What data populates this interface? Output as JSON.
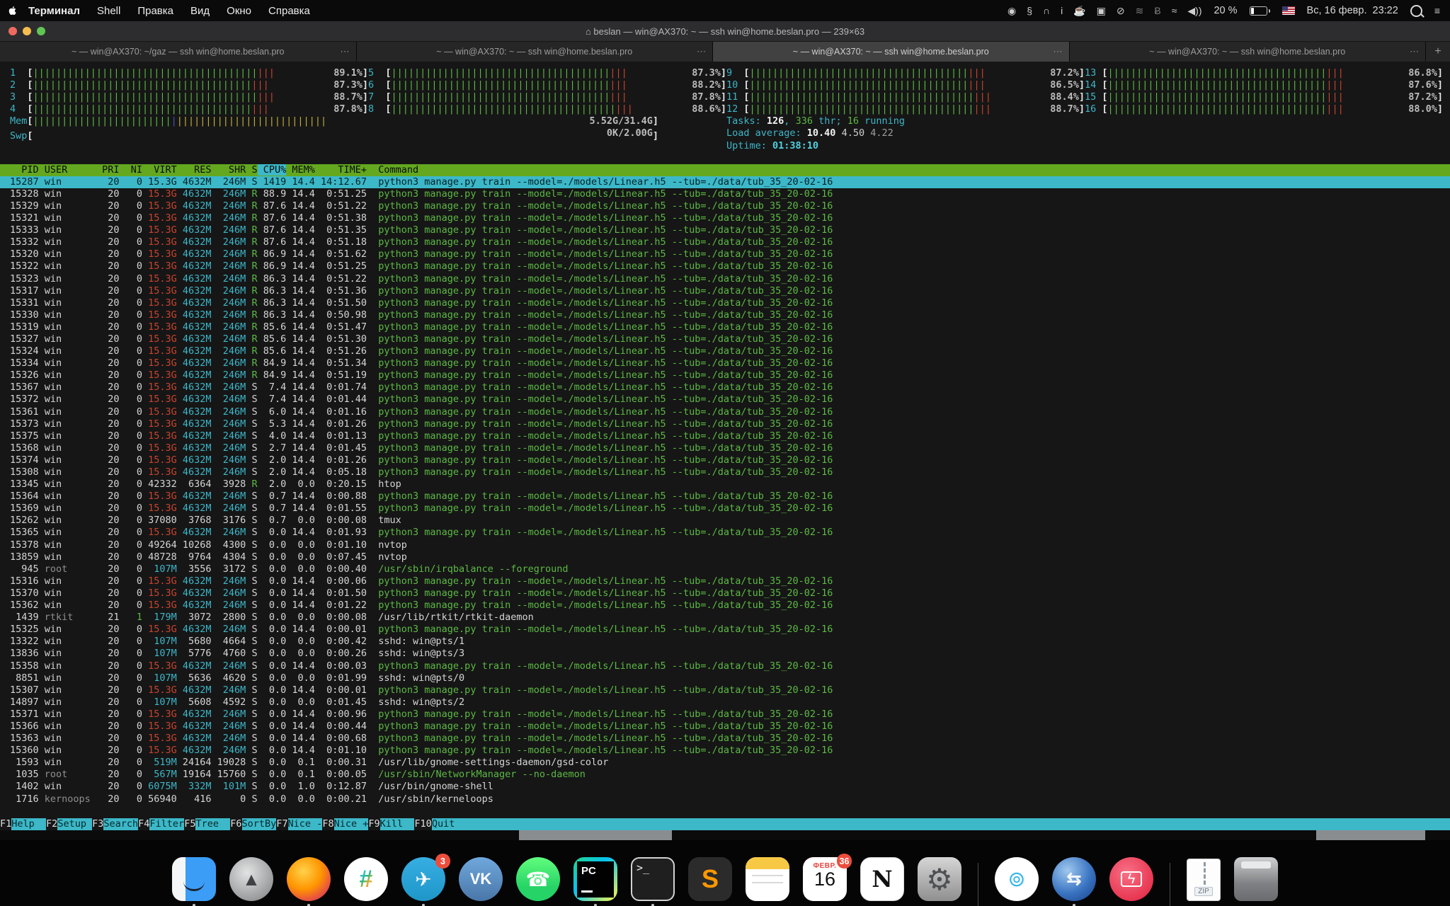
{
  "palette": {
    "bg": "#161616",
    "green": "#5cb944",
    "red": "#c8442e",
    "yellow": "#c2b13d",
    "blue": "#4d4fc9",
    "cyan": "#3db6c8",
    "cyanBright": "#4fd1e0",
    "headerGreen": "#63a81f",
    "selCyan": "#3cb8c8",
    "text": "#d6d6d6",
    "gray": "#8f8f8f",
    "pct": "#bdbdbd"
  },
  "menubar": {
    "menus": [
      "Терминал",
      "Shell",
      "Правка",
      "Вид",
      "Окно",
      "Справка"
    ],
    "status": {
      "battery_pct": "20 %",
      "clock": "Вс, 16 февр.  23:22"
    },
    "status_icons": [
      {
        "name": "circle-alert-icon",
        "glyph": "◉"
      },
      {
        "name": "gear-shift-icon",
        "glyph": "§"
      },
      {
        "name": "magnet-icon",
        "glyph": "∩"
      },
      {
        "name": "info-icon",
        "glyph": "i"
      },
      {
        "name": "coffee-charge-icon",
        "glyph": "☕"
      },
      {
        "name": "shortcuts-icon",
        "glyph": "▣"
      },
      {
        "name": "do-not-disturb-icon",
        "glyph": "⊘"
      },
      {
        "name": "wireless-signal-icon",
        "glyph": "≋"
      },
      {
        "name": "bluetooth-icon",
        "glyph": "Ƀ"
      },
      {
        "name": "wifi-icon",
        "glyph": "≈"
      },
      {
        "name": "volume-icon",
        "glyph": "◀))"
      }
    ]
  },
  "window": {
    "title": "⌂ beslan — win@AX370: ~ — ssh win@home.beslan.pro — 239×63",
    "tabs": [
      {
        "label": "~ — win@AX370: ~/gaz — ssh win@home.beslan.pro",
        "active": false
      },
      {
        "label": "~ — win@AX370: ~ — ssh win@home.beslan.pro",
        "active": false
      },
      {
        "label": "~ — win@AX370: ~ — ssh win@home.beslan.pro",
        "active": true
      },
      {
        "label": "~ — win@AX370: ~ — ssh win@home.beslan.pro",
        "active": false
      }
    ],
    "new_tab_label": "+"
  },
  "htop": {
    "cpus": [
      {
        "n": "1",
        "pct": 89.1
      },
      {
        "n": "2",
        "pct": 87.3
      },
      {
        "n": "3",
        "pct": 88.7
      },
      {
        "n": "4",
        "pct": 87.8
      },
      {
        "n": "5",
        "pct": 87.3
      },
      {
        "n": "6",
        "pct": 88.2
      },
      {
        "n": "7",
        "pct": 87.8
      },
      {
        "n": "8",
        "pct": 88.6
      },
      {
        "n": "9",
        "pct": 87.2
      },
      {
        "n": "10",
        "pct": 86.5
      },
      {
        "n": "11",
        "pct": 88.4
      },
      {
        "n": "12",
        "pct": 88.7
      },
      {
        "n": "13",
        "pct": 86.8
      },
      {
        "n": "14",
        "pct": 87.6
      },
      {
        "n": "15",
        "pct": 87.2
      },
      {
        "n": "16",
        "pct": 88.0
      }
    ],
    "mem": {
      "label": "Mem",
      "value": "5.52G/31.4G",
      "bars": {
        "green": 24,
        "blue": 1,
        "yellow": 26
      }
    },
    "swp": {
      "label": "Swp",
      "value": "0K/2.00G",
      "bars": {
        "green": 0,
        "blue": 0,
        "yellow": 0
      }
    },
    "tasks": {
      "count": "126",
      "threads": "336",
      "running": "16"
    },
    "load": {
      "one": "10.40",
      "five": "4.50",
      "fifteen": "4.22"
    },
    "uptime": "01:38:10",
    "columns": [
      "PID",
      "USER",
      "PRI",
      "NI",
      "VIRT",
      "RES",
      "SHR",
      "S",
      "CPU%",
      "MEM%",
      "TIME+",
      "Command"
    ],
    "sort_column": "CPU%",
    "python_command": "python3 manage.py train --model=./models/Linear.h5 --tub=./data/tub_35_20-02-16",
    "processes": [
      [
        "15287",
        "win",
        "20",
        "0",
        "15.3G",
        "4632M",
        "246M",
        "S",
        "1419",
        "14.4",
        "14:12.67",
        "@PY",
        "gs"
      ],
      [
        "15328",
        "win",
        "20",
        "0",
        "15.3G",
        "4632M",
        "246M",
        "R",
        "88.9",
        "14.4",
        "0:51.25",
        "@PY",
        "g"
      ],
      [
        "15329",
        "win",
        "20",
        "0",
        "15.3G",
        "4632M",
        "246M",
        "R",
        "87.6",
        "14.4",
        "0:51.22",
        "@PY",
        "g"
      ],
      [
        "15321",
        "win",
        "20",
        "0",
        "15.3G",
        "4632M",
        "246M",
        "R",
        "87.6",
        "14.4",
        "0:51.38",
        "@PY",
        "g"
      ],
      [
        "15333",
        "win",
        "20",
        "0",
        "15.3G",
        "4632M",
        "246M",
        "R",
        "87.6",
        "14.4",
        "0:51.35",
        "@PY",
        "g"
      ],
      [
        "15332",
        "win",
        "20",
        "0",
        "15.3G",
        "4632M",
        "246M",
        "R",
        "87.6",
        "14.4",
        "0:51.18",
        "@PY",
        "g"
      ],
      [
        "15320",
        "win",
        "20",
        "0",
        "15.3G",
        "4632M",
        "246M",
        "R",
        "86.9",
        "14.4",
        "0:51.62",
        "@PY",
        "g"
      ],
      [
        "15322",
        "win",
        "20",
        "0",
        "15.3G",
        "4632M",
        "246M",
        "R",
        "86.9",
        "14.4",
        "0:51.25",
        "@PY",
        "g"
      ],
      [
        "15323",
        "win",
        "20",
        "0",
        "15.3G",
        "4632M",
        "246M",
        "R",
        "86.3",
        "14.4",
        "0:51.22",
        "@PY",
        "g"
      ],
      [
        "15317",
        "win",
        "20",
        "0",
        "15.3G",
        "4632M",
        "246M",
        "R",
        "86.3",
        "14.4",
        "0:51.36",
        "@PY",
        "g"
      ],
      [
        "15331",
        "win",
        "20",
        "0",
        "15.3G",
        "4632M",
        "246M",
        "R",
        "86.3",
        "14.4",
        "0:51.50",
        "@PY",
        "g"
      ],
      [
        "15330",
        "win",
        "20",
        "0",
        "15.3G",
        "4632M",
        "246M",
        "R",
        "86.3",
        "14.4",
        "0:50.98",
        "@PY",
        "g"
      ],
      [
        "15319",
        "win",
        "20",
        "0",
        "15.3G",
        "4632M",
        "246M",
        "R",
        "85.6",
        "14.4",
        "0:51.47",
        "@PY",
        "g"
      ],
      [
        "15327",
        "win",
        "20",
        "0",
        "15.3G",
        "4632M",
        "246M",
        "R",
        "85.6",
        "14.4",
        "0:51.30",
        "@PY",
        "g"
      ],
      [
        "15324",
        "win",
        "20",
        "0",
        "15.3G",
        "4632M",
        "246M",
        "R",
        "85.6",
        "14.4",
        "0:51.26",
        "@PY",
        "g"
      ],
      [
        "15334",
        "win",
        "20",
        "0",
        "15.3G",
        "4632M",
        "246M",
        "R",
        "84.9",
        "14.4",
        "0:51.34",
        "@PY",
        "g"
      ],
      [
        "15326",
        "win",
        "20",
        "0",
        "15.3G",
        "4632M",
        "246M",
        "R",
        "84.9",
        "14.4",
        "0:51.19",
        "@PY",
        "g"
      ],
      [
        "15367",
        "win",
        "20",
        "0",
        "15.3G",
        "4632M",
        "246M",
        "S",
        "7.4",
        "14.4",
        "0:01.74",
        "@PY",
        "g"
      ],
      [
        "15372",
        "win",
        "20",
        "0",
        "15.3G",
        "4632M",
        "246M",
        "S",
        "7.4",
        "14.4",
        "0:01.44",
        "@PY",
        "g"
      ],
      [
        "15361",
        "win",
        "20",
        "0",
        "15.3G",
        "4632M",
        "246M",
        "S",
        "6.0",
        "14.4",
        "0:01.16",
        "@PY",
        "g"
      ],
      [
        "15373",
        "win",
        "20",
        "0",
        "15.3G",
        "4632M",
        "246M",
        "S",
        "5.3",
        "14.4",
        "0:01.26",
        "@PY",
        "g"
      ],
      [
        "15375",
        "win",
        "20",
        "0",
        "15.3G",
        "4632M",
        "246M",
        "S",
        "4.0",
        "14.4",
        "0:01.13",
        "@PY",
        "g"
      ],
      [
        "15368",
        "win",
        "20",
        "0",
        "15.3G",
        "4632M",
        "246M",
        "S",
        "2.7",
        "14.4",
        "0:01.45",
        "@PY",
        "g"
      ],
      [
        "15374",
        "win",
        "20",
        "0",
        "15.3G",
        "4632M",
        "246M",
        "S",
        "2.0",
        "14.4",
        "0:01.26",
        "@PY",
        "g"
      ],
      [
        "15308",
        "win",
        "20",
        "0",
        "15.3G",
        "4632M",
        "246M",
        "S",
        "2.0",
        "14.4",
        "0:05.18",
        "@PY",
        "g"
      ],
      [
        "13345",
        "win",
        "20",
        "0",
        "42332",
        "6364",
        "3928",
        "R",
        "2.0",
        "0.0",
        "0:20.15",
        "htop",
        ""
      ],
      [
        "15364",
        "win",
        "20",
        "0",
        "15.3G",
        "4632M",
        "246M",
        "S",
        "0.7",
        "14.4",
        "0:00.88",
        "@PY",
        "g"
      ],
      [
        "15369",
        "win",
        "20",
        "0",
        "15.3G",
        "4632M",
        "246M",
        "S",
        "0.7",
        "14.4",
        "0:01.55",
        "@PY",
        "g"
      ],
      [
        "15262",
        "win",
        "20",
        "0",
        "37080",
        "3768",
        "3176",
        "S",
        "0.7",
        "0.0",
        "0:00.08",
        "tmux",
        ""
      ],
      [
        "15365",
        "win",
        "20",
        "0",
        "15.3G",
        "4632M",
        "246M",
        "S",
        "0.0",
        "14.4",
        "0:01.93",
        "@PY",
        "g"
      ],
      [
        "15378",
        "win",
        "20",
        "0",
        "49264",
        "10268",
        "4300",
        "S",
        "0.0",
        "0.0",
        "0:01.10",
        "nvtop",
        ""
      ],
      [
        "13859",
        "win",
        "20",
        "0",
        "48728",
        "9764",
        "4304",
        "S",
        "0.0",
        "0.0",
        "0:07.45",
        "nvtop",
        ""
      ],
      [
        "945",
        "root",
        "20",
        "0",
        "107M",
        "3556",
        "3172",
        "S",
        "0.0",
        "0.0",
        "0:00.40",
        "/usr/sbin/irqbalance --foreground",
        "g"
      ],
      [
        "15316",
        "win",
        "20",
        "0",
        "15.3G",
        "4632M",
        "246M",
        "S",
        "0.0",
        "14.4",
        "0:00.06",
        "@PY",
        "g"
      ],
      [
        "15370",
        "win",
        "20",
        "0",
        "15.3G",
        "4632M",
        "246M",
        "S",
        "0.0",
        "14.4",
        "0:01.50",
        "@PY",
        "g"
      ],
      [
        "15362",
        "win",
        "20",
        "0",
        "15.3G",
        "4632M",
        "246M",
        "S",
        "0.0",
        "14.4",
        "0:01.22",
        "@PY",
        "g"
      ],
      [
        "1439",
        "rtkit",
        "21",
        "1",
        "179M",
        "3072",
        "2800",
        "S",
        "0.0",
        "0.0",
        "0:00.08",
        "/usr/lib/rtkit/rtkit-daemon",
        ""
      ],
      [
        "15325",
        "win",
        "20",
        "0",
        "15.3G",
        "4632M",
        "246M",
        "S",
        "0.0",
        "14.4",
        "0:00.01",
        "@PY",
        "g"
      ],
      [
        "13322",
        "win",
        "20",
        "0",
        "107M",
        "5680",
        "4664",
        "S",
        "0.0",
        "0.0",
        "0:00.42",
        "sshd: win@pts/1",
        ""
      ],
      [
        "13836",
        "win",
        "20",
        "0",
        "107M",
        "5776",
        "4760",
        "S",
        "0.0",
        "0.0",
        "0:00.26",
        "sshd: win@pts/3",
        ""
      ],
      [
        "15358",
        "win",
        "20",
        "0",
        "15.3G",
        "4632M",
        "246M",
        "S",
        "0.0",
        "14.4",
        "0:00.03",
        "@PY",
        "g"
      ],
      [
        "8851",
        "win",
        "20",
        "0",
        "107M",
        "5636",
        "4620",
        "S",
        "0.0",
        "0.0",
        "0:01.99",
        "sshd: win@pts/0",
        ""
      ],
      [
        "15307",
        "win",
        "20",
        "0",
        "15.3G",
        "4632M",
        "246M",
        "S",
        "0.0",
        "14.4",
        "0:00.01",
        "@PY",
        "g"
      ],
      [
        "14897",
        "win",
        "20",
        "0",
        "107M",
        "5608",
        "4592",
        "S",
        "0.0",
        "0.0",
        "0:01.45",
        "sshd: win@pts/2",
        ""
      ],
      [
        "15371",
        "win",
        "20",
        "0",
        "15.3G",
        "4632M",
        "246M",
        "S",
        "0.0",
        "14.4",
        "0:00.96",
        "@PY",
        "g"
      ],
      [
        "15366",
        "win",
        "20",
        "0",
        "15.3G",
        "4632M",
        "246M",
        "S",
        "0.0",
        "14.4",
        "0:00.44",
        "@PY",
        "g"
      ],
      [
        "15363",
        "win",
        "20",
        "0",
        "15.3G",
        "4632M",
        "246M",
        "S",
        "0.0",
        "14.4",
        "0:00.68",
        "@PY",
        "g"
      ],
      [
        "15360",
        "win",
        "20",
        "0",
        "15.3G",
        "4632M",
        "246M",
        "S",
        "0.0",
        "14.4",
        "0:01.10",
        "@PY",
        "g"
      ],
      [
        "1593",
        "win",
        "20",
        "0",
        "519M",
        "24164",
        "19028",
        "S",
        "0.0",
        "0.1",
        "0:00.31",
        "/usr/lib/gnome-settings-daemon/gsd-color",
        ""
      ],
      [
        "1035",
        "root",
        "20",
        "0",
        "567M",
        "19164",
        "15760",
        "S",
        "0.0",
        "0.1",
        "0:00.05",
        "/usr/sbin/NetworkManager --no-daemon",
        "g"
      ],
      [
        "1402",
        "win",
        "20",
        "0",
        "6075M",
        "332M",
        "101M",
        "S",
        "0.0",
        "1.0",
        "0:12.87",
        "/usr/bin/gnome-shell",
        ""
      ],
      [
        "1716",
        "kernoops",
        "20",
        "0",
        "56940",
        "416",
        "0",
        "S",
        "0.0",
        "0.0",
        "0:00.21",
        "/usr/sbin/kerneloops",
        ""
      ]
    ],
    "fkeys": [
      {
        "key": "F1",
        "label": "Help  "
      },
      {
        "key": "F2",
        "label": "Setup "
      },
      {
        "key": "F3",
        "label": "Search"
      },
      {
        "key": "F4",
        "label": "Filter"
      },
      {
        "key": "F5",
        "label": "Tree  "
      },
      {
        "key": "F6",
        "label": "SortBy"
      },
      {
        "key": "F7",
        "label": "Nice -"
      },
      {
        "key": "F8",
        "label": "Nice +"
      },
      {
        "key": "F9",
        "label": "Kill  "
      },
      {
        "key": "F10",
        "label": "Quit"
      }
    ]
  },
  "dock": {
    "items": [
      {
        "name": "finder",
        "running": true
      },
      {
        "name": "launchpad",
        "running": false
      },
      {
        "name": "firefox",
        "running": true
      },
      {
        "name": "slack",
        "running": false
      },
      {
        "name": "telegram",
        "running": true,
        "badge": "3"
      },
      {
        "name": "vk",
        "running": false,
        "label": "VK"
      },
      {
        "name": "whatsapp",
        "running": false
      },
      {
        "name": "pycharm",
        "running": true,
        "label": "PC"
      },
      {
        "name": "terminal",
        "running": true,
        "label": ">_"
      },
      {
        "name": "sublime-text",
        "running": false,
        "label": "S"
      },
      {
        "name": "notes",
        "running": false
      },
      {
        "name": "calendar",
        "running": false,
        "month": "ФЕВР.",
        "day": "16",
        "badge": "36"
      },
      {
        "name": "notion",
        "running": false,
        "label": "N"
      },
      {
        "name": "system-preferences",
        "running": false
      },
      {
        "name": "separator"
      },
      {
        "name": "remote-wifi-app",
        "running": false
      },
      {
        "name": "sync-globe-app",
        "running": true
      },
      {
        "name": "battery-device-app",
        "running": false
      },
      {
        "name": "separator"
      },
      {
        "name": "zip-file",
        "label": "ZIP"
      },
      {
        "name": "trash"
      }
    ]
  }
}
